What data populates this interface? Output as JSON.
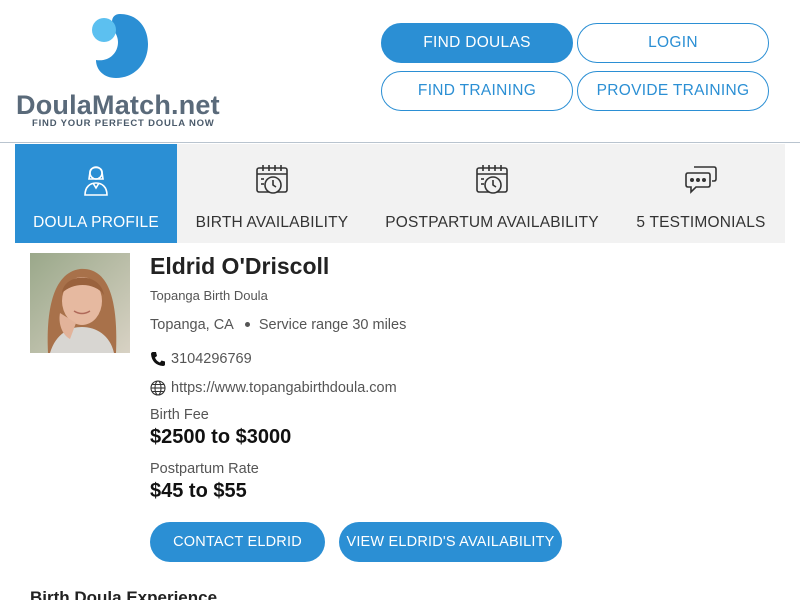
{
  "brand": {
    "name_main": "DoulaMatch",
    "name_suffix": ".net",
    "tagline": "FIND YOUR PERFECT DOULA NOW",
    "colors": {
      "primary": "#2b8fd4",
      "logo_light": "#5cc0f0",
      "logo_dark": "#2b8fd4"
    }
  },
  "nav": {
    "find_doulas": "FIND DOULAS",
    "login": "LOGIN",
    "find_training": "FIND TRAINING",
    "provide_training": "PROVIDE TRAINING"
  },
  "tabs": [
    {
      "label": "DOULA PROFILE",
      "icon": "doula-person-icon",
      "active": true
    },
    {
      "label": "BIRTH AVAILABILITY",
      "icon": "calendar-clock-icon",
      "active": false
    },
    {
      "label": "POSTPARTUM AVAILABILITY",
      "icon": "calendar-clock-icon",
      "active": false
    },
    {
      "label": "5 TESTIMONIALS",
      "icon": "chat-bubbles-icon",
      "active": false
    }
  ],
  "profile": {
    "name": "Eldrid O'Driscoll",
    "subtitle": "Topanga Birth Doula",
    "location": "Topanga, CA",
    "service_range": "Service range 30 miles",
    "phone": "3104296769",
    "website": "https://www.topangabirthdoula.com",
    "birth_fee_label": "Birth Fee",
    "birth_fee_value": "$2500 to $3000",
    "postpartum_label": "Postpartum Rate",
    "postpartum_value": "$45 to $55",
    "contact_button": "CONTACT ELDRID",
    "availability_button": "VIEW ELDRID'S AVAILABILITY"
  },
  "sections": {
    "experience_heading": "Birth Doula Experience"
  }
}
